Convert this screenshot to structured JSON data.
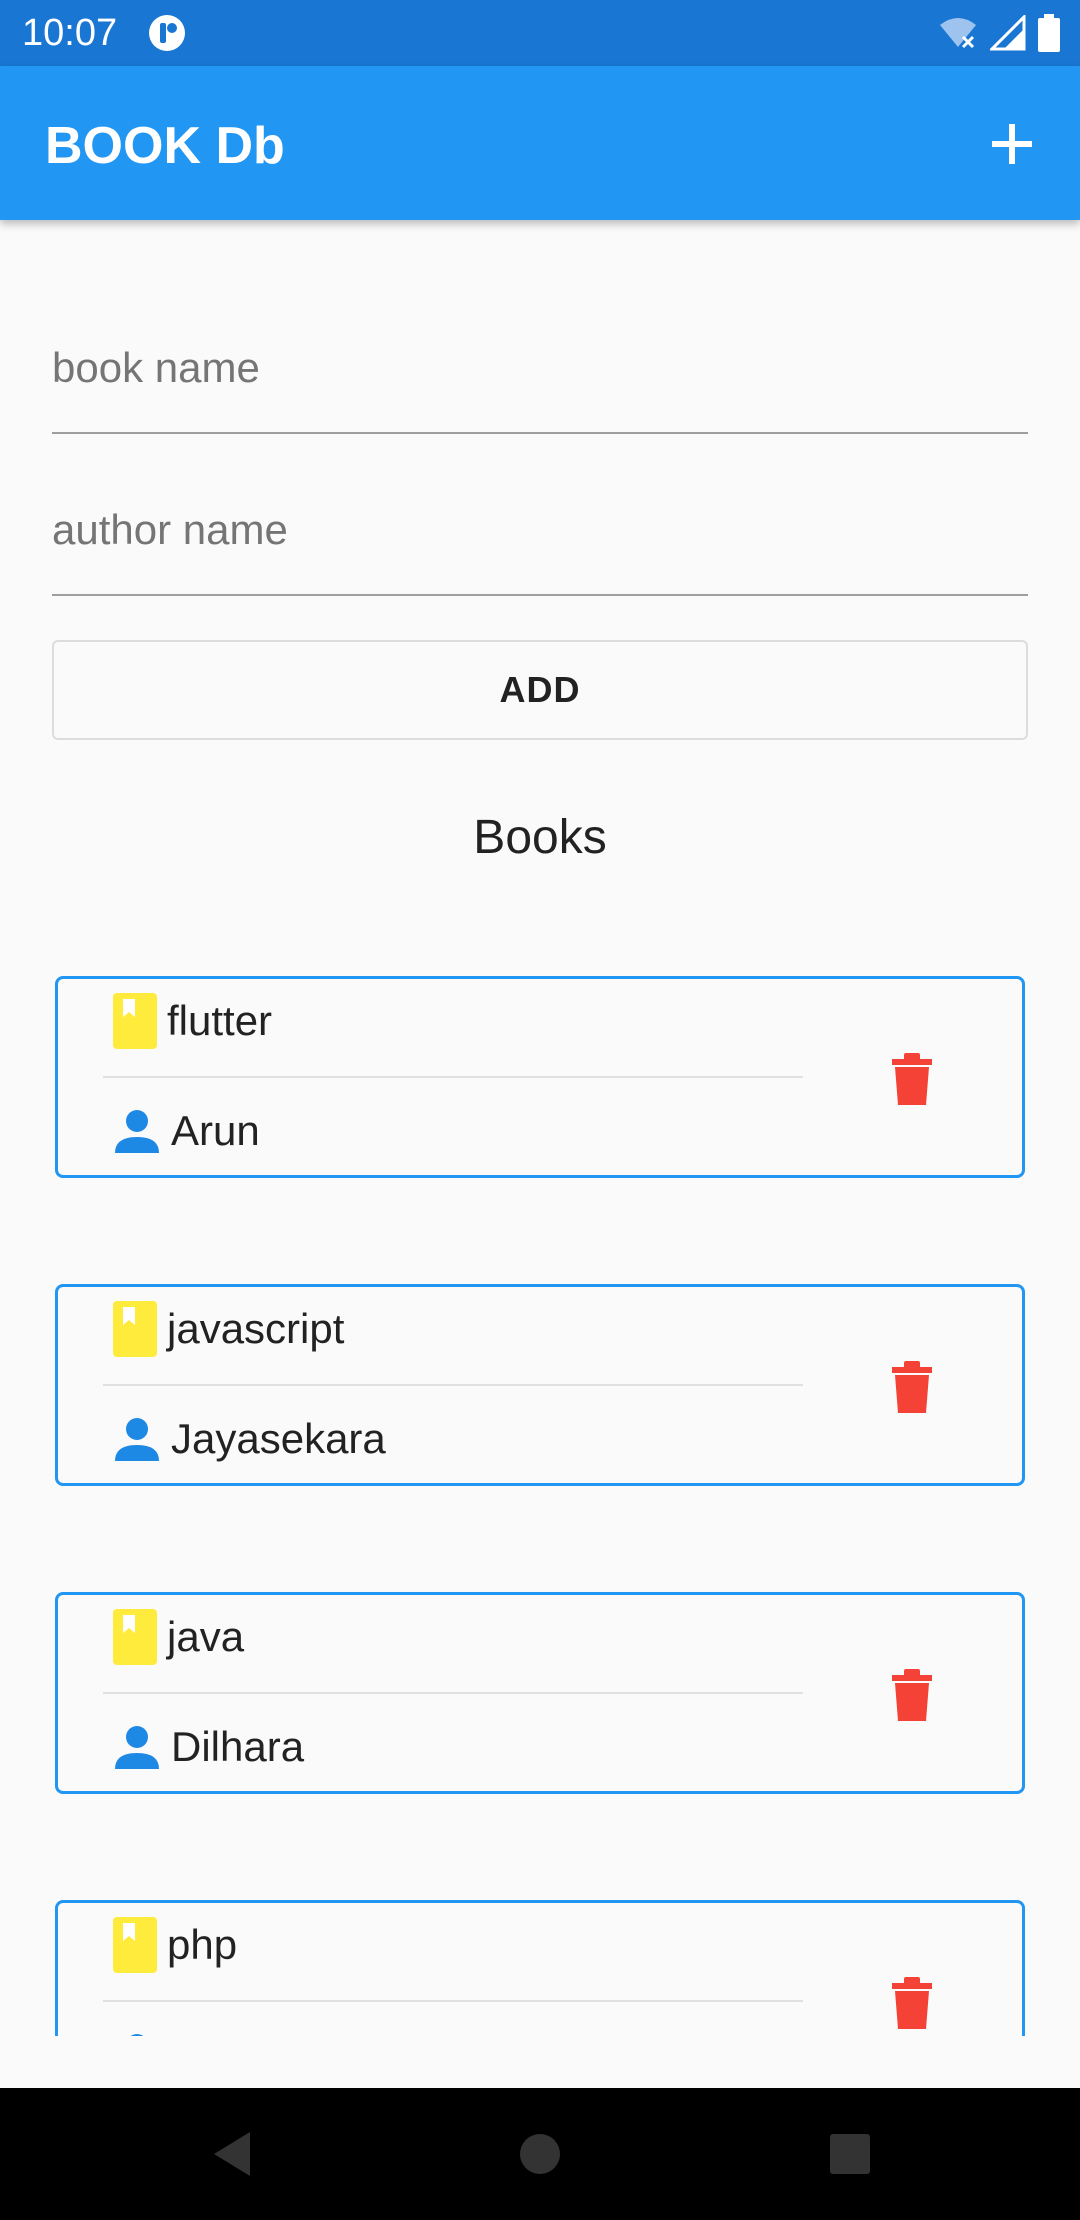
{
  "status_bar": {
    "time": "10:07",
    "icons": [
      "app-notification-icon",
      "wifi-icon",
      "signal-icon",
      "battery-icon"
    ]
  },
  "app_bar": {
    "title": "BOOK Db",
    "action_icon": "add-icon",
    "color": "#2196f3",
    "status_color": "#1976d2"
  },
  "form": {
    "book_placeholder": "book name",
    "book_value": "",
    "author_placeholder": "author name",
    "author_value": "",
    "add_label": "ADD"
  },
  "section_title": "Books",
  "books": [
    {
      "title": "flutter",
      "author": "Arun"
    },
    {
      "title": "javascript",
      "author": "Jayasekara"
    },
    {
      "title": "java",
      "author": "Dilhara"
    },
    {
      "title": "php",
      "author": ""
    }
  ],
  "icons": {
    "book": "bookmark-icon",
    "author": "person-icon",
    "delete": "delete-icon"
  },
  "colors": {
    "card_border": "#2196f3",
    "book_icon": "#ffeb3b",
    "person_icon": "#1e88e5",
    "delete_icon": "#f44336"
  },
  "nav_bar": {
    "buttons": [
      "back-icon",
      "home-icon",
      "recents-icon"
    ]
  }
}
